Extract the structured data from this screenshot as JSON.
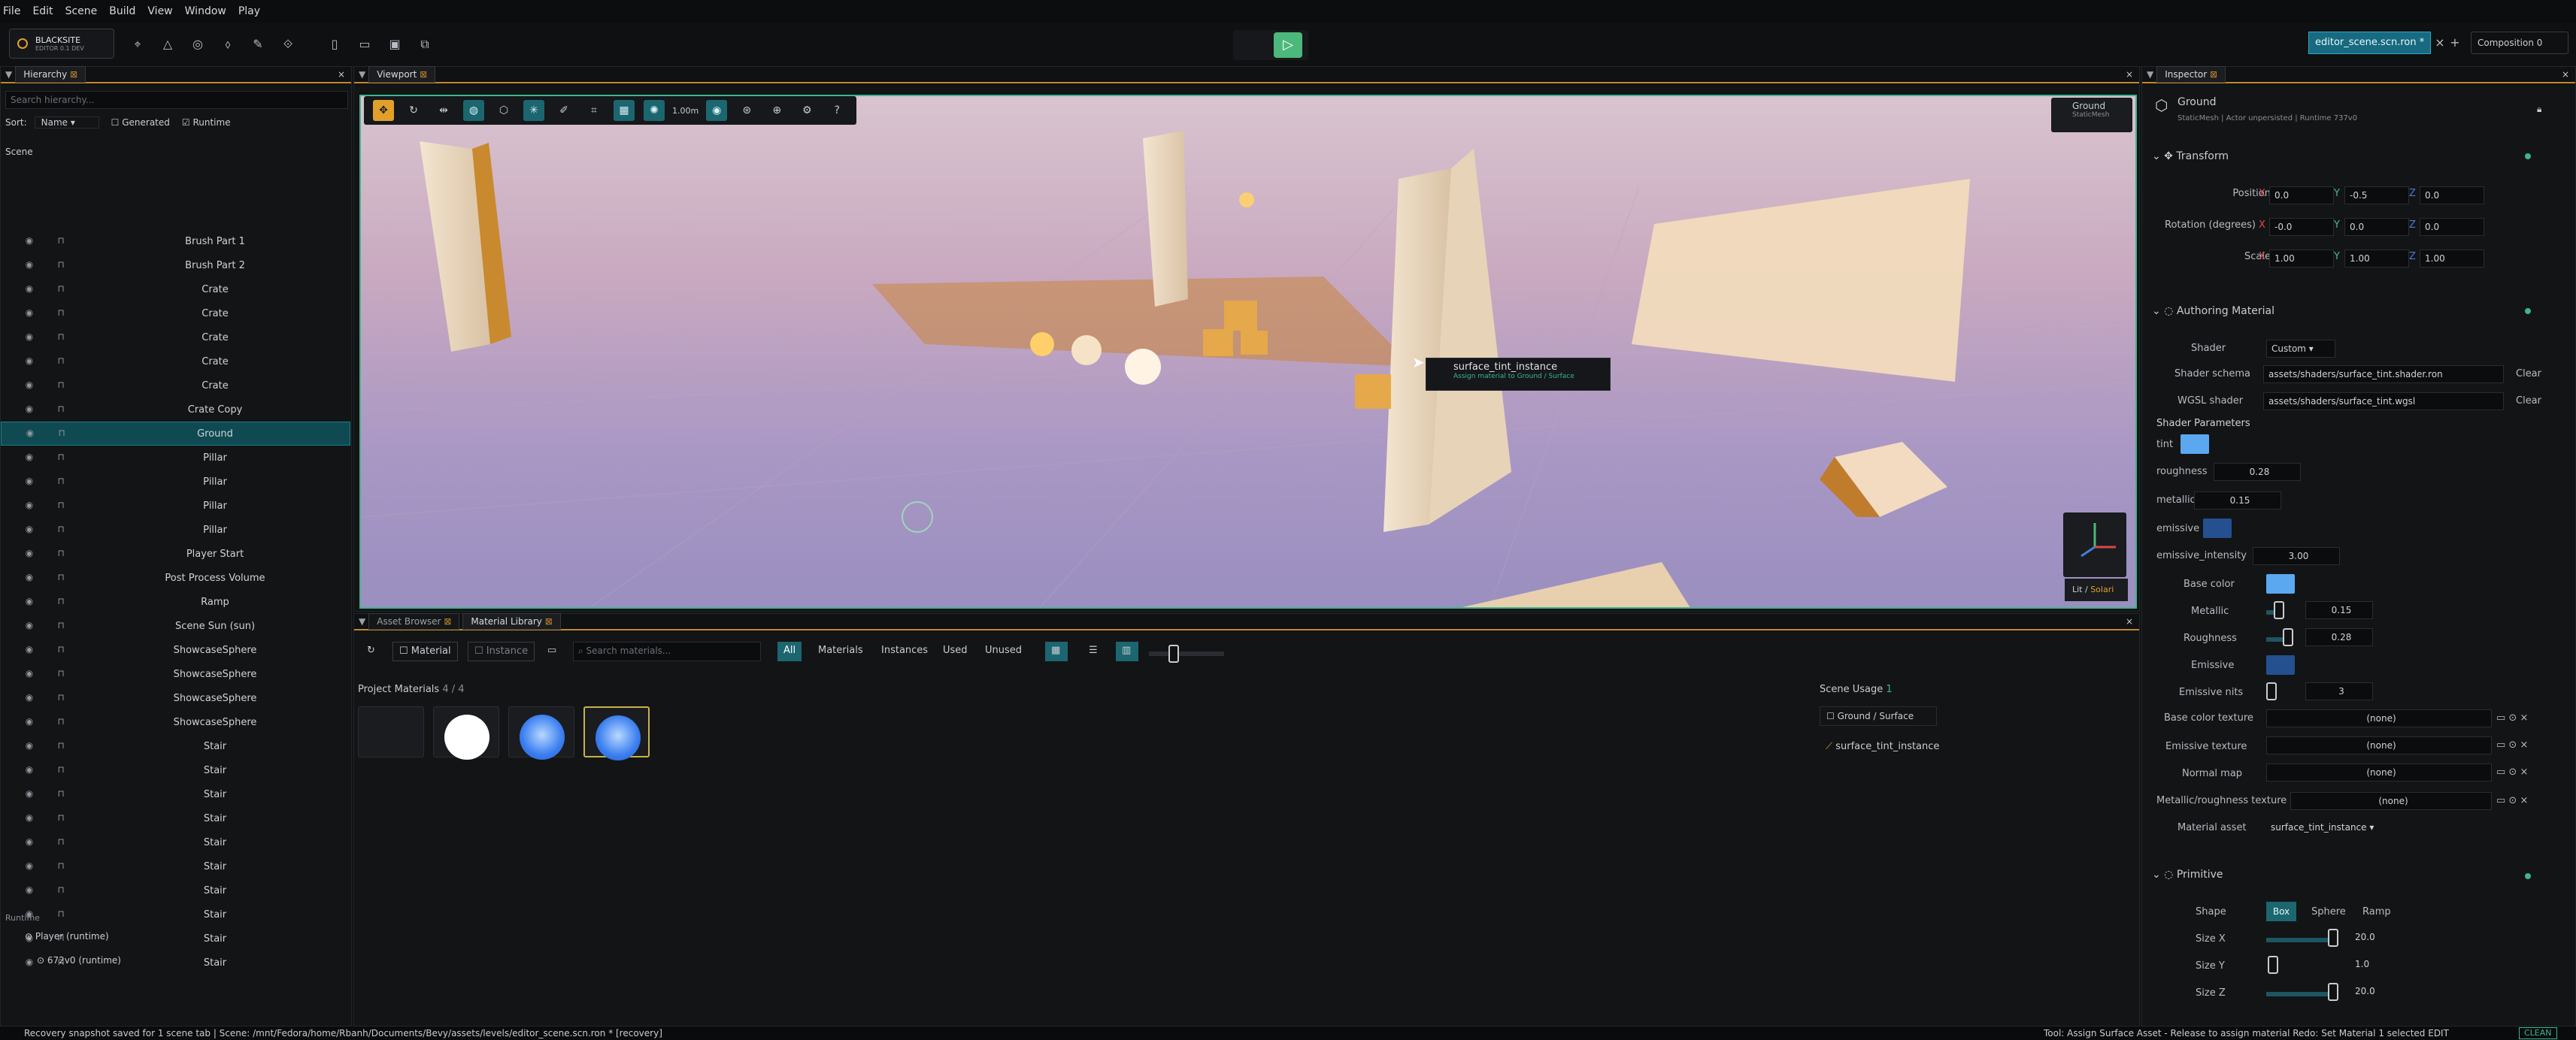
{
  "menu": [
    "File",
    "Edit",
    "Scene",
    "Build",
    "View",
    "Window",
    "Play"
  ],
  "logo": {
    "name": "BLACKSITE",
    "sub": "EDITOR 0.1 DEV"
  },
  "toolbar": {
    "file_tab": "editor_scene.scn.ron *",
    "composition": "Composition 0"
  },
  "hierarchy": {
    "tab": "Hierarchy",
    "search_placeholder": "Search hierarchy...",
    "sort_label": "Sort:",
    "sort_value": "Name",
    "generated": "Generated",
    "runtime": "Runtime",
    "scene_label": "Scene",
    "items": [
      "Brush Part 1",
      "Brush Part 2",
      "Crate",
      "Crate",
      "Crate",
      "Crate",
      "Crate",
      "Crate Copy",
      "Ground",
      "Pillar",
      "Pillar",
      "Pillar",
      "Pillar",
      "Player Start",
      "Post Process Volume",
      "Ramp",
      "Scene Sun (sun)",
      "ShowcaseSphere",
      "ShowcaseSphere",
      "ShowcaseSphere",
      "ShowcaseSphere",
      "Stair",
      "Stair",
      "Stair",
      "Stair",
      "Stair",
      "Stair",
      "Stair",
      "Stair",
      "Stair",
      "Stair"
    ],
    "runtime_section": "Runtime",
    "runtime_items": [
      "Player (runtime)",
      "672v0 (runtime)"
    ]
  },
  "viewport": {
    "tab": "Viewport",
    "distance": "1.00m",
    "selected_name": "Ground",
    "selected_type": "StaticMesh",
    "lit": "Lit",
    "solari": "Solari",
    "tooltip_title": "surface_tint_instance",
    "tooltip_sub": "Assign material to Ground / Surface"
  },
  "library": {
    "tab_assets": "Asset Browser",
    "tab_library": "Material Library",
    "material_btn": "Material",
    "instance_btn": "Instance",
    "search_placeholder": "Search materials...",
    "filters": [
      "All",
      "Materials",
      "Instances",
      "Used",
      "Unused"
    ],
    "project_label": "Project Materials",
    "project_count": "4 / 4",
    "scene_usage": "Scene Usage",
    "usage_count": "1",
    "usage_target": "Ground / Surface",
    "usage_material": "surface_tint_instance"
  },
  "inspector": {
    "tab": "Inspector",
    "name": "Ground",
    "meta": "StaticMesh | Actor unpersisted | Runtime 737v0",
    "transform": "Transform",
    "position": {
      "label": "Position",
      "x": "0.0",
      "y": "-0.5",
      "z": "0.0"
    },
    "rotation": {
      "label": "Rotation (degrees)",
      "x": "-0.0",
      "y": "0.0",
      "z": "0.0"
    },
    "scale": {
      "label": "Scale",
      "x": "1.00",
      "y": "1.00",
      "z": "1.00"
    },
    "authoring": "Authoring Material",
    "shader_label": "Shader",
    "shader_value": "Custom",
    "schema_label": "Shader schema",
    "schema_value": "assets/shaders/surface_tint.shader.ron",
    "clear": "Clear",
    "wgsl_label": "WGSL shader",
    "wgsl_value": "assets/shaders/surface_tint.wgsl",
    "params_label": "Shader Parameters",
    "tint": "tint",
    "roughness_label": "roughness",
    "roughness": "0.28",
    "metallic_label": "metallic",
    "metallic": "0.15",
    "emissive_label": "emissive",
    "emissive_int_label": "emissive_intensity",
    "emissive_int": "3.00",
    "base_color": "Base color",
    "metallic2_label": "Metallic",
    "metallic2": "0.15",
    "roughness2_label": "Roughness",
    "roughness2": "0.28",
    "emissive2": "Emissive",
    "emissive_nits_label": "Emissive nits",
    "emissive_nits": "3",
    "base_tex": "Base color texture",
    "emis_tex": "Emissive texture",
    "normal_map": "Normal map",
    "mr_tex": "Metallic/roughness texture",
    "none": "(none)",
    "material_asset_label": "Material asset",
    "material_asset": "surface_tint_instance",
    "primitive": "Primitive",
    "shape_label": "Shape",
    "shapes": [
      "Box",
      "Sphere",
      "Ramp"
    ],
    "sizex_label": "Size X",
    "sizex": "20.0",
    "sizey_label": "Size Y",
    "sizey": "1.0",
    "sizez_label": "Size Z",
    "sizez": "20.0",
    "colors": {
      "tint": "#5ba8f0",
      "emissive": "#24508f",
      "accent": "#3db68c"
    }
  },
  "status": {
    "left": "Recovery snapshot saved for 1 scene tab  |  Scene: /mnt/Fedora/home/Rbanh/Documents/Bevy/assets/levels/editor_scene.scn.ron * [recovery]",
    "right": "Tool: Assign Surface Asset - Release to assign material   Redo: Set Material   1 selected   EDIT",
    "clean": "CLEAN"
  }
}
